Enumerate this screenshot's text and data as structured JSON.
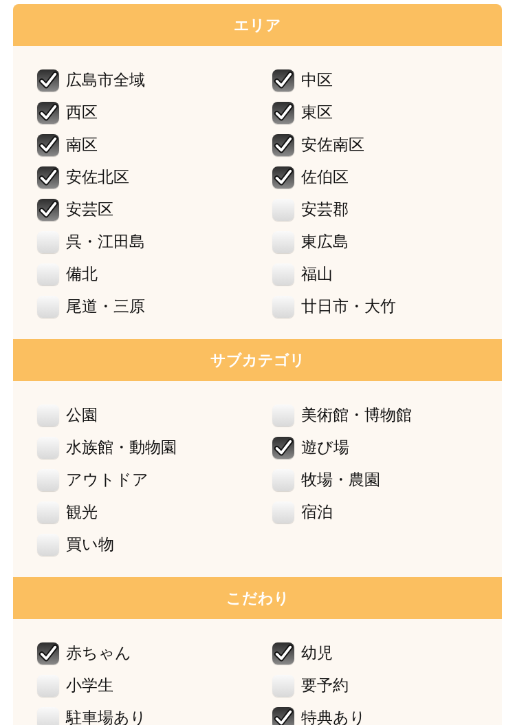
{
  "sections": [
    {
      "title": "エリア",
      "items": [
        {
          "label": "広島市全域",
          "checked": true
        },
        {
          "label": "中区",
          "checked": true
        },
        {
          "label": "西区",
          "checked": true
        },
        {
          "label": "東区",
          "checked": true
        },
        {
          "label": "南区",
          "checked": true
        },
        {
          "label": "安佐南区",
          "checked": true
        },
        {
          "label": "安佐北区",
          "checked": true
        },
        {
          "label": "佐伯区",
          "checked": true
        },
        {
          "label": "安芸区",
          "checked": true
        },
        {
          "label": "安芸郡",
          "checked": false
        },
        {
          "label": "呉・江田島",
          "checked": false
        },
        {
          "label": "東広島",
          "checked": false
        },
        {
          "label": "備北",
          "checked": false
        },
        {
          "label": "福山",
          "checked": false
        },
        {
          "label": "尾道・三原",
          "checked": false
        },
        {
          "label": "廿日市・大竹",
          "checked": false
        }
      ]
    },
    {
      "title": "サブカテゴリ",
      "items": [
        {
          "label": "公園",
          "checked": false
        },
        {
          "label": "美術館・博物館",
          "checked": false
        },
        {
          "label": "水族館・動物園",
          "checked": false
        },
        {
          "label": "遊び場",
          "checked": true
        },
        {
          "label": "アウトドア",
          "checked": false
        },
        {
          "label": "牧場・農園",
          "checked": false
        },
        {
          "label": "観光",
          "checked": false
        },
        {
          "label": "宿泊",
          "checked": false
        },
        {
          "label": "買い物",
          "checked": false
        }
      ]
    },
    {
      "title": "こだわり",
      "items": [
        {
          "label": "赤ちゃん",
          "checked": true
        },
        {
          "label": "幼児",
          "checked": true
        },
        {
          "label": "小学生",
          "checked": false
        },
        {
          "label": "要予約",
          "checked": false
        },
        {
          "label": "駐車場あり",
          "checked": false
        },
        {
          "label": "特典あり",
          "checked": true
        }
      ]
    }
  ]
}
